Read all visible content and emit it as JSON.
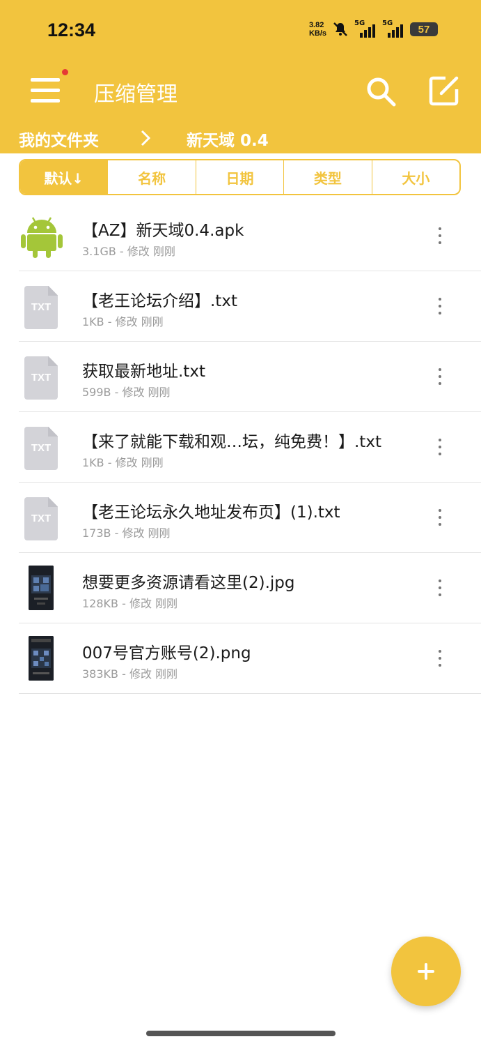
{
  "status_bar": {
    "time": "12:34",
    "net_speed_value": "3.82",
    "net_speed_unit": "KB/s",
    "sim1_label": "5G",
    "sim2_label": "5G",
    "battery": "57"
  },
  "app_bar": {
    "title": "压缩管理",
    "menu_icon": "hamburger-menu-icon",
    "search_icon": "search-icon",
    "edit_icon": "edit-icon",
    "accent_color": "#F2C43E"
  },
  "breadcrumb": {
    "root": "我的文件夹",
    "current": "新天域 0.4"
  },
  "sort_tabs": [
    {
      "label": "默认↓",
      "active": true
    },
    {
      "label": "名称",
      "active": false
    },
    {
      "label": "日期",
      "active": false
    },
    {
      "label": "类型",
      "active": false
    },
    {
      "label": "大小",
      "active": false
    }
  ],
  "files": [
    {
      "name": "【AZ】新天域0.4.apk",
      "meta": "3.1GB - 修改 刚刚",
      "icon": "android-icon"
    },
    {
      "name": "【老王论坛介绍】.txt",
      "meta": "1KB - 修改 刚刚",
      "icon": "txt-file-icon",
      "icon_label": "TXT"
    },
    {
      "name": "获取最新地址.txt",
      "meta": "599B - 修改 刚刚",
      "icon": "txt-file-icon",
      "icon_label": "TXT"
    },
    {
      "name": "【来了就能下载和观…坛，纯免费！】.txt",
      "meta": "1KB - 修改 刚刚",
      "icon": "txt-file-icon",
      "icon_label": "TXT"
    },
    {
      "name": "【老王论坛永久地址发布页】(1).txt",
      "meta": "173B - 修改 刚刚",
      "icon": "txt-file-icon",
      "icon_label": "TXT"
    },
    {
      "name": "想要更多资源请看这里(2).jpg",
      "meta": "128KB - 修改 刚刚",
      "icon": "image-thumbnail"
    },
    {
      "name": "007号官方账号(2).png",
      "meta": "383KB - 修改 刚刚",
      "icon": "image-thumbnail"
    }
  ],
  "fab": {
    "icon": "plus-icon"
  }
}
